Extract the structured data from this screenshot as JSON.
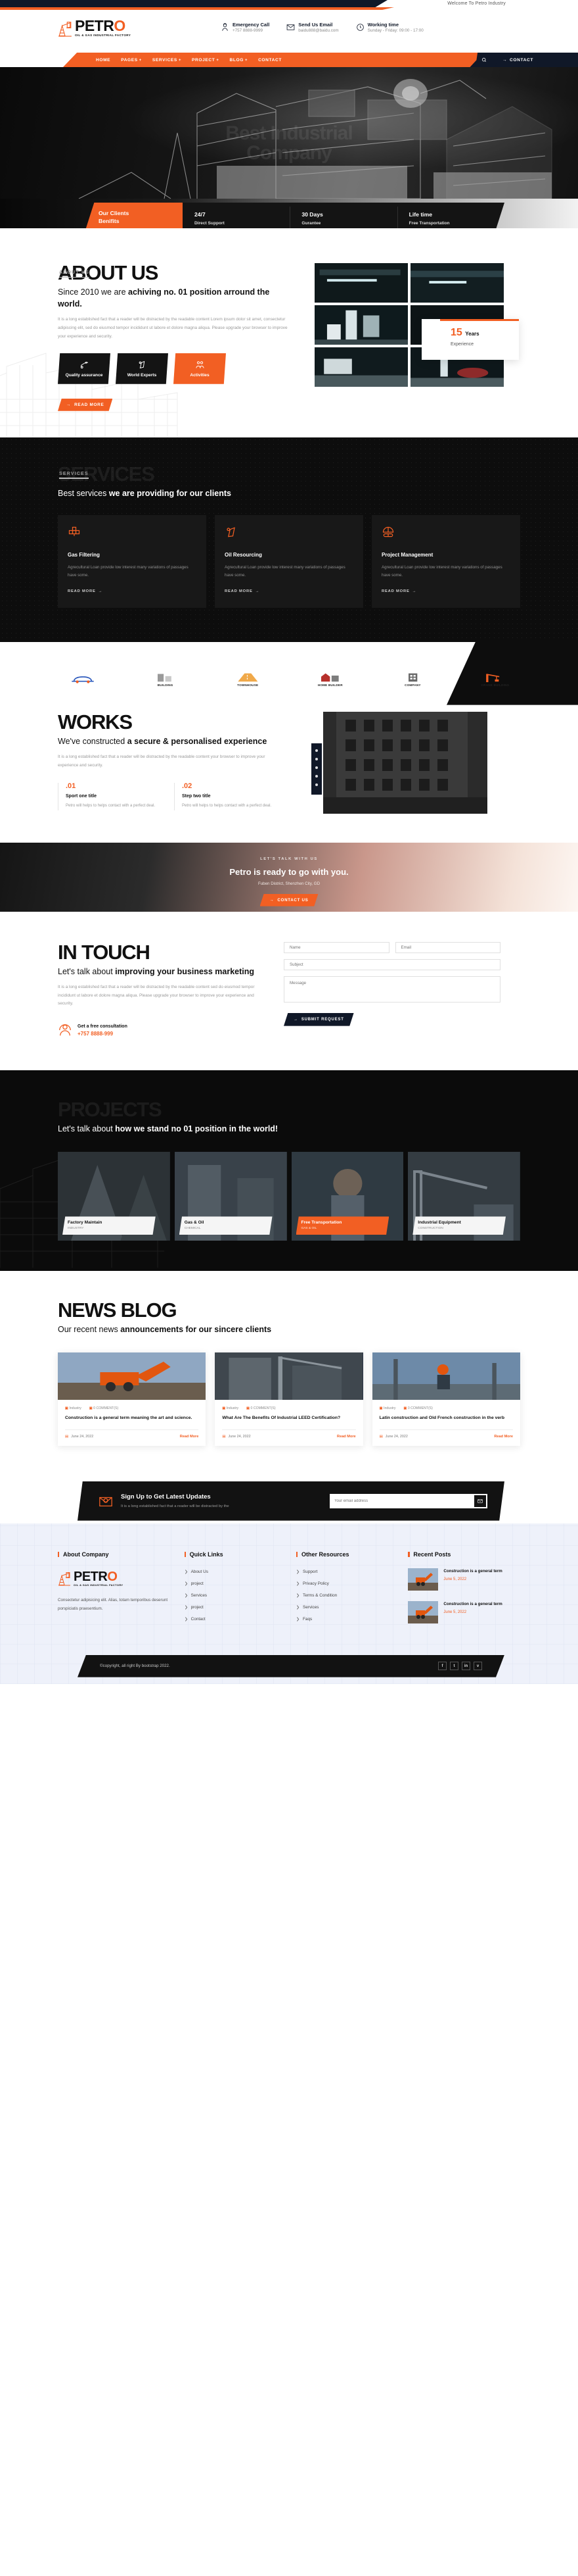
{
  "topbar": {
    "welcome": "Welcome To Petro Industry"
  },
  "brand": {
    "name": "PETR",
    "accent_letter": "O",
    "tagline": "OIL & GAS INDUSTRIAL FACTORY",
    "accent_color": "#f25f23"
  },
  "header_contacts": [
    {
      "icon": "headset-icon",
      "title": "Emergency Call",
      "value": "+757 8888-9999"
    },
    {
      "icon": "envelope-icon",
      "title": "Send Us Email",
      "value": "baidu888@baidu.com"
    },
    {
      "icon": "clock-icon",
      "title": "Working time",
      "value": "Sunday - Friday: 09:00 - 17:00"
    }
  ],
  "nav": {
    "items": [
      {
        "label": "HOME",
        "caret": ""
      },
      {
        "label": "PAGES",
        "caret": "+"
      },
      {
        "label": "SERVICES",
        "caret": "+"
      },
      {
        "label": "PROJECT",
        "caret": "+"
      },
      {
        "label": "BLOG",
        "caret": "+"
      },
      {
        "label": "CONTACT",
        "caret": ""
      }
    ],
    "contact_button": "CONTACT"
  },
  "hero": {
    "watermark_line1": "Best Industrial",
    "watermark_line2": "Company"
  },
  "benefits": {
    "first_line1": "Our Clients",
    "first_line2": "Benifits",
    "items": [
      {
        "title": "24/7",
        "subtitle": "Direct Support"
      },
      {
        "title": "30 Days",
        "subtitle": "Gurantee"
      },
      {
        "title": "Life time",
        "subtitle": "Free Transportation"
      }
    ]
  },
  "about": {
    "ghost": "ABOUT US",
    "kicker": "ABOUT US",
    "heading_normal": "Since 2010 we are ",
    "heading_bold": "achiving no. 01 position arround the world.",
    "paragraph": "It is a long established fact that a reader will be distracted by the readable content Lorem ipsum dolor sit amet, consectetur adipiscing elit, sed do eiusmod tempor incididunt ut labore et dolore magna aliqua. Please upgrade your browser to improve your experience and security.",
    "chips": [
      {
        "icon": "safety-pin-icon",
        "label": "Quality assurance"
      },
      {
        "icon": "fuel-nozzle-icon",
        "label": "World Experts"
      },
      {
        "icon": "workers-icon",
        "label": "Activities"
      }
    ],
    "read_more": "READ MORE",
    "experience_number": "15",
    "experience_years": "Years",
    "experience_label": "Experience"
  },
  "services": {
    "ghost": "SERVICES",
    "kicker": "SERVICES",
    "heading_normal": "Best services ",
    "heading_bold": "we are providing for our clients",
    "cards": [
      {
        "icon": "pipe-valve-icon",
        "title": "Gas Filtering",
        "text": "Agrecultural Loan provide low interest many variations of passages have some.",
        "link": "READ MORE"
      },
      {
        "icon": "fuel-nozzle-icon",
        "title": "Oil Resourcing",
        "text": "Agrecultural Loan provide low interest many variations of passages have some.",
        "link": "READ MORE"
      },
      {
        "icon": "helmet-goggles-icon",
        "title": "Project Management",
        "text": "Agrecultural Loan provide low interest many variations of passages have some.",
        "link": "READ MORE"
      }
    ]
  },
  "brands": [
    {
      "icon": "car-icon",
      "name": ""
    },
    {
      "icon": "building-icon",
      "name": "BUILDING"
    },
    {
      "icon": "road-icon",
      "name": "TOWNHOUSE"
    },
    {
      "icon": "house-icon",
      "name": "HOME BUILDER"
    },
    {
      "icon": "company-icon",
      "name": "COMPANY"
    },
    {
      "icon": "crane-icon",
      "name": "CRANE BUILDING"
    }
  ],
  "works": {
    "ghost": "WORKS",
    "kicker": "",
    "heading_normal": "We've constructed ",
    "heading_bold": "a secure & personalised experience",
    "paragraph": "It is a long established fact that a reader will be distracted by the readable content your browser to improve your experience and security.",
    "steps": [
      {
        "num": ".01",
        "title": "Sport one title",
        "text": "Petro will helps to helps contact with a perfect deal."
      },
      {
        "num": ".02",
        "title": "Step two title",
        "text": "Petro will helps to helps contact with a perfect deal."
      }
    ]
  },
  "cta": {
    "kicker": "LET'S TALK WITH US",
    "heading": "Petro is ready to go with you.",
    "subtitle": "Fuben District, Shenzhen City, GD",
    "button": "CONTACT US"
  },
  "intouch": {
    "ghost": "IN TOUCH",
    "kicker": "",
    "heading_normal": "Let's talk about ",
    "heading_bold": "improving your business marketing",
    "paragraph": "It is a long established fact that a reader will be distracted by the readable content sed do eiusmod tempor incididunt ut labore et dolore magna aliqua. Please upgrade your browser to improve your experience and security.",
    "consult_icon": "support-agent-icon",
    "consult_title": "Get a free consultation",
    "consult_phone": "+757 8888-999",
    "form": {
      "name_placeholder": "Name",
      "email_placeholder": "Email",
      "subject_placeholder": "Subject",
      "message_placeholder": "Message",
      "submit_label": "SUBMIT REQUEST"
    }
  },
  "projects": {
    "ghost": "PROJECTS",
    "kicker": "",
    "heading_normal": "Let's talk about ",
    "heading_bold": "how we stand no 01 position in the world!",
    "cards": [
      {
        "title": "Factory Maintain",
        "subtitle": "INDUSTRY",
        "highlight": false
      },
      {
        "title": "Gas & Oil",
        "subtitle": "CHEMICAL",
        "highlight": false
      },
      {
        "title": "Free Transportation",
        "subtitle": "GAS & OIL",
        "highlight": true
      },
      {
        "title": "Industrial Equipment",
        "subtitle": "CONSTRUCTION",
        "highlight": false
      }
    ]
  },
  "news": {
    "ghost": "NEWS BLOG",
    "kicker": "",
    "heading_normal": "Our recent news ",
    "heading_bold": "announcements for our sincere clients",
    "cards": [
      {
        "tag1": "Industry",
        "tag2": "0 COMMENT(S)",
        "title": "Construction is a general term meaning the art and science.",
        "date": "June 24, 2022",
        "read_more": "Read More"
      },
      {
        "tag1": "Industry",
        "tag2": "0 COMMENT(S)",
        "title": "What Are The Benefits Of Industrial LEED Certification?",
        "date": "June 24, 2022",
        "read_more": "Read More"
      },
      {
        "tag1": "Industry",
        "tag2": "0 COMMENT(S)",
        "title": "Latin construction and Old French construction in the verb",
        "date": "June 24, 2022",
        "read_more": "Read More"
      }
    ]
  },
  "newsletter": {
    "icon": "email-at-icon",
    "title": "Sign Up to Get Latest Updates",
    "subtitle": "It is a long established fact that a reader will be distracted by the",
    "placeholder": "Your email address",
    "button_icon": "send-envelope-icon"
  },
  "footer": {
    "col_about_title": "About Company",
    "about_text": "Consectetur adipisicing elit. Alias, totam temporibus deserunt porspiciatis praesentium.",
    "col_quick_title": "Quick Links",
    "quick_links": [
      "About Us",
      "project",
      "Services",
      "project",
      "Contact"
    ],
    "col_other_title": "Other Resources",
    "other_links": [
      "Support",
      "Privacy Policy",
      "Terms & Condition",
      "Services",
      "Faqs"
    ],
    "col_recent_title": "Recent Posts",
    "recent_posts": [
      {
        "title": "Construction is a general term",
        "date": "June 5, 2022"
      },
      {
        "title": "Construction is a general term",
        "date": "June 5, 2022"
      }
    ],
    "copyright": "©copyright, all right By bootstrap 2022.",
    "socials": [
      "f",
      "t",
      "in",
      "v"
    ]
  }
}
